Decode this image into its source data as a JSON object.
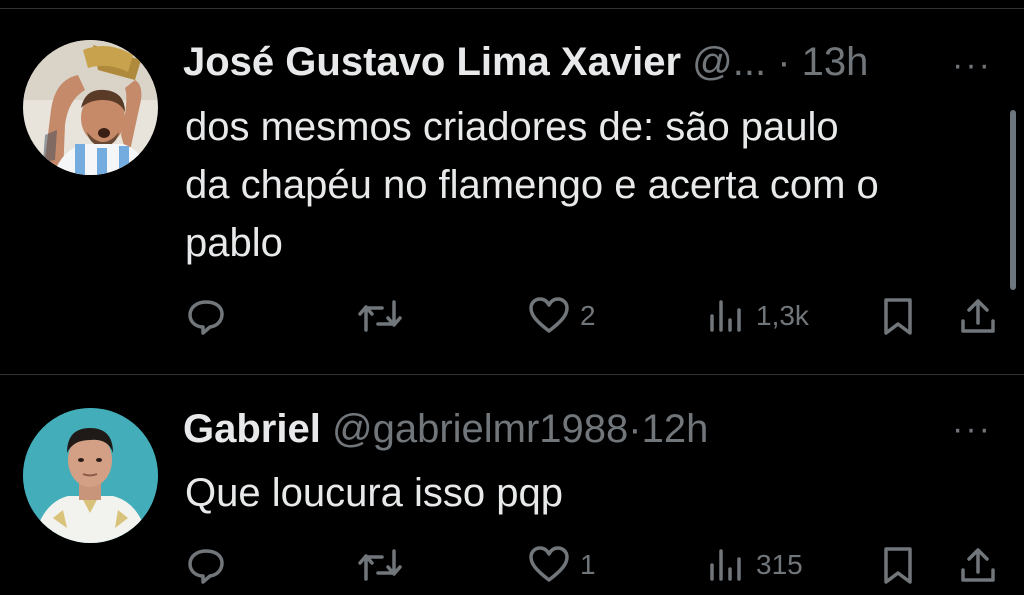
{
  "tweets": [
    {
      "name": "José Gustavo Lima Xavier",
      "handle": "@...",
      "dot": "·",
      "time": "13h",
      "text_lines": [
        "dos mesmos criadores de: são paulo",
        "da chapéu no flamengo e acerta com o",
        "pablo"
      ],
      "likes": "2",
      "views": "1,3k",
      "avatar_icon": "avatar-trophy-player"
    },
    {
      "name": "Gabriel",
      "handle": "@gabrielmr1988",
      "dot": "·",
      "time": "12h",
      "text_lines": [
        "Que loucura isso pqp"
      ],
      "likes": "1",
      "views": "315",
      "avatar_icon": "avatar-man"
    }
  ],
  "more_label": "···",
  "icons": [
    "reply-icon",
    "retweet-icon",
    "like-icon",
    "views-icon",
    "bookmark-icon",
    "share-icon"
  ],
  "colors": {
    "background": "#000000",
    "text": "#e7e9ea",
    "muted": "#71767b",
    "divider": "#2f3336"
  }
}
